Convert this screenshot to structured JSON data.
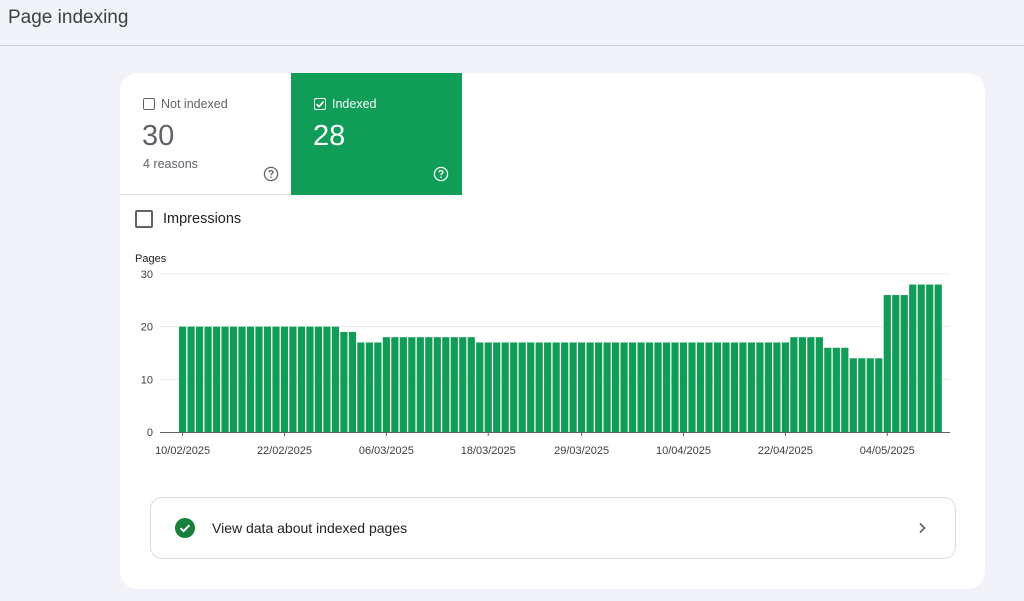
{
  "header": {
    "title": "Page indexing"
  },
  "tiles": {
    "not_indexed": {
      "label": "Not indexed",
      "value": "30",
      "sub": "4 reasons",
      "checked": false
    },
    "indexed": {
      "label": "Indexed",
      "value": "28",
      "checked": true
    }
  },
  "impressions": {
    "label": "Impressions",
    "checked": false
  },
  "colors": {
    "accent": "#0f9d58",
    "bar": "#0f9d58",
    "check_green": "#188038"
  },
  "chart_data": {
    "type": "bar",
    "ylabel": "Pages",
    "ylim": [
      0,
      30
    ],
    "yticks": [
      0,
      10,
      20,
      30
    ],
    "grid": true,
    "xtick_labels": [
      "10/02/2025",
      "22/02/2025",
      "06/03/2025",
      "18/03/2025",
      "29/03/2025",
      "10/04/2025",
      "22/04/2025",
      "04/05/2025"
    ],
    "xtick_indices": [
      0,
      12,
      24,
      36,
      47,
      59,
      71,
      83
    ],
    "series": [
      {
        "values": [
          20,
          20,
          20,
          20,
          20,
          20,
          20,
          20,
          20,
          20,
          20,
          20,
          20,
          20,
          20,
          20,
          20,
          20,
          20,
          19,
          19,
          17,
          17,
          17,
          18,
          18,
          18,
          18,
          18,
          18,
          18,
          18,
          18,
          18,
          18,
          17,
          17,
          17,
          17,
          17,
          17,
          17,
          17,
          17,
          17,
          17,
          17,
          17,
          17,
          17,
          17,
          17,
          17,
          17,
          17,
          17,
          17,
          17,
          17,
          17,
          17,
          17,
          17,
          17,
          17,
          17,
          17,
          17,
          17,
          17,
          17,
          17,
          18,
          18,
          18,
          18,
          16,
          16,
          16,
          14,
          14,
          14,
          14,
          26,
          26,
          26,
          28,
          28,
          28,
          28
        ]
      }
    ]
  },
  "view_row": {
    "label": "View data about indexed pages"
  }
}
